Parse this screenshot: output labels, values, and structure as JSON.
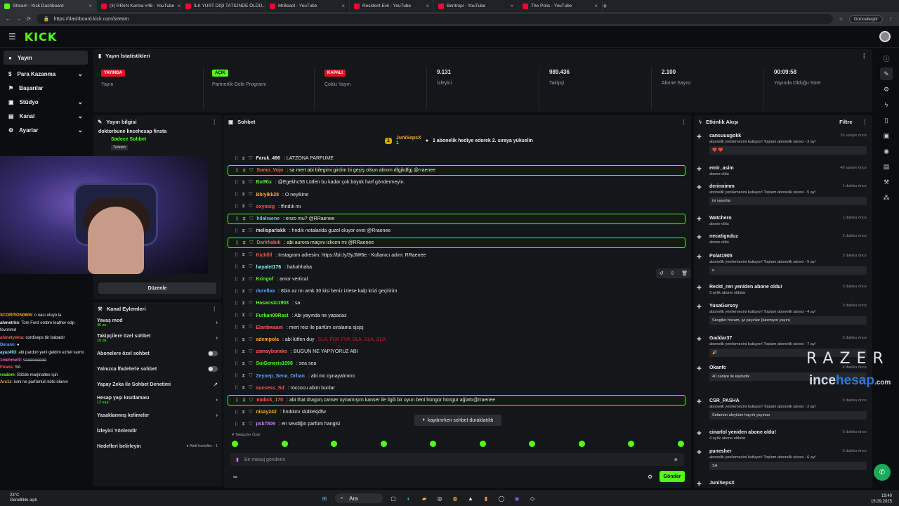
{
  "browser": {
    "tabs": [
      {
        "title": "Stream - Kick Dashboard",
        "color": "#53fc18"
      },
      {
        "title": "(3) RReN Karma #48 - YouTube",
        "color": "#ff0033"
      },
      {
        "title": "İLK YURT DIŞI TATİLİNDE ÖLDÜ...",
        "color": "#ff0033"
      },
      {
        "title": "MrBeast - YouTube",
        "color": "#ff0033"
      },
      {
        "title": "Resident Evil - YouTube",
        "color": "#ff0033"
      },
      {
        "title": "Bentropi - YouTube",
        "color": "#ff0033"
      },
      {
        "title": "The Polis - YouTube",
        "color": "#ff0033"
      }
    ],
    "url": "https://dashboard.kick.com/stream",
    "update_label": "Güncelleştir"
  },
  "header": {
    "logo": "KICK"
  },
  "nav": [
    {
      "label": "Yayın",
      "active": true
    },
    {
      "label": "Para Kazanma",
      "chev": true
    },
    {
      "label": "Başarılar"
    },
    {
      "label": "Stüdyo",
      "chev": true
    },
    {
      "label": "Kanal",
      "chev": true
    },
    {
      "label": "Ayarlar",
      "chev": true
    }
  ],
  "stats": {
    "title": "Yayın İstatistikleri",
    "items": [
      {
        "badge": "YAYINDA",
        "badge_color": "#e0141e",
        "label": "Yayın"
      },
      {
        "badge": "AÇIK",
        "badge_color": "#53fc18",
        "label": "Partnerlik Gelir Programı"
      },
      {
        "badge": "KAPALI",
        "badge_color": "#e0141e",
        "label": "Çoklu Yayın"
      },
      {
        "value": "9.131",
        "label": "İzleyici"
      },
      {
        "value": "989.436",
        "label": "Takipçi"
      },
      {
        "value": "2.100",
        "label": "Abone Sayısı"
      },
      {
        "value": "00:09:58",
        "label": "Yayında Olduğu Süre"
      }
    ]
  },
  "stream_info": {
    "title": "Yayın bilgisi",
    "stream_title": "doktorbune lincehesap finsta",
    "mode": "Sadece Sohbet",
    "lang": "Turkish",
    "edit": "Düzenle"
  },
  "overlay_chat": [
    {
      "u": "SCORPION0606",
      "c": "#f5a623",
      "m": ": o nası oluyo la"
    },
    {
      "u": "ahmetrkn",
      "c": "#e9e9e9",
      "m": ": Tom Ford ombre leather edp favorimd"
    },
    {
      "u": "ahmetyekta",
      "c": "#f55",
      "m": ": cordiseps bir babadır"
    },
    {
      "u": "Derann",
      "c": "#5aa0ff",
      "m": ": ●"
    },
    {
      "u": "ayaz493",
      "c": "#8ef",
      "m": ": abi pardon yeni geldim ezhel varmı"
    },
    {
      "u": "1mehmet0",
      "c": "#f5c",
      "m": ": saaaaaaaaa"
    },
    {
      "u": "Firans",
      "c": "#f55",
      "m": ": SA"
    },
    {
      "u": "rradom",
      "c": "#53fc18",
      "m": ": Sözde marjinallee için"
    },
    {
      "u": "Ars1z",
      "c": "#f5a623",
      "m": ": ismi ne parfümün kötü olanın"
    }
  ],
  "channel_actions": {
    "title": "Kanal Eylemleri",
    "items": [
      {
        "label": "Yavaş mod",
        "sub": "45 sn.",
        "type": "chev"
      },
      {
        "label": "Takipçilere özel sohbet",
        "sub": "10 dk.",
        "type": "chev"
      },
      {
        "label": "Abonelere özel sohbet",
        "type": "toggle"
      },
      {
        "label": "Yalnızca İfadelerle sohbet",
        "type": "toggle"
      },
      {
        "label": "Yapay Zeka ile Sohbet Denetimi",
        "type": "ext"
      },
      {
        "label": "Hesap yaşı kısıtlaması",
        "sub": "12 saa.",
        "type": "chev"
      },
      {
        "label": "Yasaklanmış kelimeler",
        "type": "chev"
      },
      {
        "label": "İzleyici Yönlendir",
        "type": "none"
      },
      {
        "label": "Hedefleri belirleyin",
        "type": "goal",
        "extra": "● Aktif hedefler - 1"
      }
    ]
  },
  "chat": {
    "title": "Sohbet",
    "pinned_user": "JuniSepsX",
    "pinned_count": "1",
    "pinned_text": "1 abonelik hediye ederek 2. sıraya yükselin",
    "messages": [
      {
        "u": "Faruk_466",
        "c": "#e6e6e6",
        "m": ": LATZONA PARFUME"
      },
      {
        "u": "Sumo_Vojo",
        "c": "#f55",
        "m": ": sa mert abi bilegimi girdim bi geçiş olsun alınım dfgjkdfgj @rraenee",
        "hl": true
      },
      {
        "u": "BotRix",
        "c": "#53fc18",
        "m": ": @Egekhc58 Lütfen bu kadar çok büyük harf göndermeyin."
      },
      {
        "u": "Bbiyikk28",
        "c": "#f5a623",
        "m": ": O neyikine"
      },
      {
        "u": "oxynoig",
        "c": "#f55",
        "m": ": ffındık mı"
      },
      {
        "u": "hilalraene",
        "c": "#7bd",
        "m": ": enzo mu? @RRaenee",
        "hl": true
      },
      {
        "u": "melisparlakk",
        "c": "#ddd",
        "m": ": fındık notalarida guzel oluyor evet @Rraenee"
      },
      {
        "u": "Darkfiabdi",
        "c": "#f55",
        "m": ": abi aurora maçını izlicen mi @RRaenee",
        "hl": true
      },
      {
        "u": "Kickfill",
        "c": "#f55",
        "m": ": Instagram adresim: https://bit.ly/3yJlW6e - Kullanıcı adım: RRaenee"
      },
      {
        "u": "hayalet176",
        "c": "#8ef",
        "m": ": hahahhaha"
      },
      {
        "u": "Kringof",
        "c": "#53fc18",
        "m": ": amor vertical"
      },
      {
        "u": "durellaa",
        "c": "#5aa0ff",
        "m": ": 8bin az mı amk 30 kisi beniz izlese kalp krizi geçiririm"
      },
      {
        "u": "Hasansio1903",
        "c": "#53fc18",
        "m": ": sa"
      },
      {
        "u": "Furkan09Rast",
        "c": "#53fc18",
        "m": ": Abi yayında ne yapacaz"
      },
      {
        "u": "Elanbwaani",
        "c": "#f55",
        "m": ": mert reiz ile parfüm sıralama sjsjsj"
      },
      {
        "u": "adempola",
        "c": "#f5a623",
        "m": ": abi lütfen duy ",
        "red": "SLA, FUK FUK SLA, SLA, SLA"
      },
      {
        "u": "zamayburako",
        "c": "#f55",
        "m": ": BUGUN NE YAPIYORUZ ABI"
      },
      {
        "u": "SuiGeneris1098",
        "c": "#53fc18",
        "m": ": sea sea"
      },
      {
        "u": "Zeynep_Sena_Orhan",
        "c": "#5aa0ff",
        "m": ": abi mc oynayalımmı"
      },
      {
        "u": "success_Sd",
        "c": "#f55",
        "m": ": roccocu abim bunlar"
      },
      {
        "u": "mabck_170",
        "c": "#f55",
        "m": ": abi that dragon,canser oynamışım kanser ile ilgili bir oyun beni hüngür hüngür ağlattı@rraenee",
        "hl": true
      },
      {
        "u": "nisay242",
        "c": "#f5a623",
        "m": ": fındıkmı skdkekjdfw"
      },
      {
        "u": "psk7809",
        "c": "#c7f",
        "m": ": en sevdiğin parfüm hangisi"
      }
    ],
    "paused": "kaydırırken sohbet duraklatıldı",
    "followers_only": "Takipçiler Özel",
    "placeholder": "Bir mesaj gönderin",
    "send": "Gönder"
  },
  "activity": {
    "title": "Etkinlik Akışı",
    "filter": "Filtre",
    "events": [
      {
        "n": "cansuuugokk",
        "s": "abonelik yenilemesini kutluyor! Toplam abonelik süresi - 3 ay!",
        "t": "26 saniye önce",
        "box": "❤️ ❤️"
      },
      {
        "n": "emir_asim",
        "s": "abone oldu",
        "t": "40 saniye önce"
      },
      {
        "n": "derinnimm",
        "s": "abonelik yenilemesini kutluyor! Toplam abonelik süresi - 5 ay!",
        "t": "1 dakika önce",
        "box": "iyi yayınlar"
      },
      {
        "n": "Watchero",
        "s": "abone oldu",
        "t": "1 dakika önce"
      },
      {
        "n": "necatignduz",
        "s": "abone oldu",
        "t": "2 dakika önce"
      },
      {
        "n": "Polat1905",
        "s": "abonelik yenilemesini kutluyor! Toplam abonelik süresi - 5 ay!",
        "t": "3 dakika önce",
        "box": "o"
      },
      {
        "n": "Reckt_ren yeniden abone oldu!",
        "s": "3 aylık abone oldular",
        "t": "3 dakika önce"
      },
      {
        "n": "YusaGursoy",
        "s": "abonelik yenilemesini kutluyor! Toplam abonelik süresi - 4 ay!",
        "t": "3 dakika önce",
        "box": "Sevgiler hocam, iyi yayınlar (kasmıyor yayın)"
      },
      {
        "n": "Gaddar37",
        "s": "abonelik yenilemesini kutluyor! Toplam abonelik süresi - 7 ay!",
        "t": "3 dakika önce",
        "box": "🎉"
      },
      {
        "n": "Okanfc",
        "s": "",
        "t": "4 dakika önce",
        "box": "40 saniye ile kaybetik"
      },
      {
        "n": "CSR_PASHA",
        "s": "abonelik yenilemesini kutluyor! Toplam abonelik süresi - 2 ay!",
        "t": "5 dakika önce",
        "box": "Selamün aleyküm hayırlı yayınlar"
      },
      {
        "n": "cinarlol yeniden abone oldu!",
        "s": "4 aylık abone oldular",
        "t": "5 dakika önce"
      },
      {
        "n": "punesher",
        "s": "abonelik yenilemesini kutluyor! Toplam abonelik süresi - 6 ay!",
        "t": "5 dakika önce",
        "box": "SA"
      },
      {
        "n": "JuniSepsX",
        "s": "",
        "t": ""
      }
    ]
  },
  "sponsor": {
    "razer": "RAZER",
    "ince_a": "ince",
    "ince_b": "hesap",
    "ince_c": ".com"
  },
  "taskbar": {
    "temp": "23°C",
    "weather": "Genellikle açık",
    "search": "Ara",
    "time": "19:40",
    "date": "15.09.2025"
  }
}
